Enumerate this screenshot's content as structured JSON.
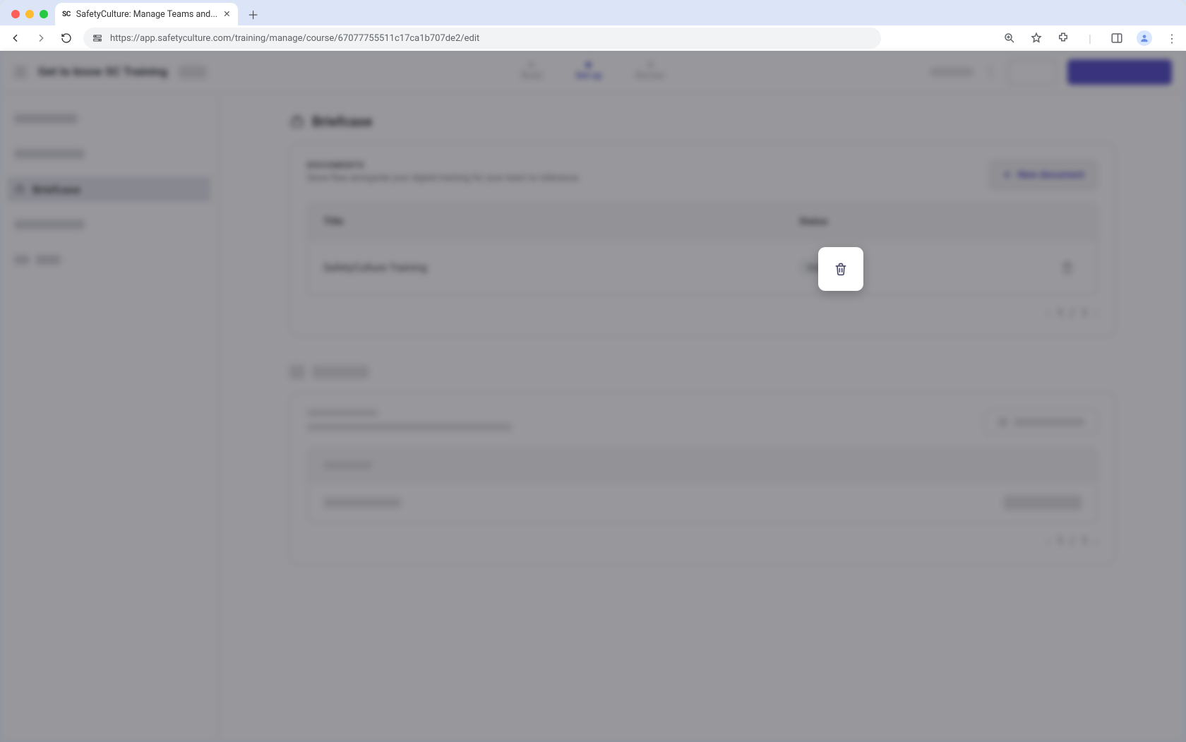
{
  "browser": {
    "tab_title": "SafetyCulture: Manage Teams and...",
    "url": "https://app.safetyculture.com/training/manage/course/67077755511c17ca1b707de2/edit"
  },
  "header": {
    "course_title": "Get to know SC Training",
    "stepper": {
      "step_build": "Build",
      "step_setup": "Set up",
      "step_review": "Review"
    }
  },
  "sidebar": {
    "active_label": "Briefcase"
  },
  "main": {
    "section_title": "Briefcase",
    "documents": {
      "label": "DOCUMENTS",
      "subtext": "Store files alongside your digital training for your team to reference.",
      "new_button": "New document",
      "columns": {
        "title": "Title",
        "status": "Status"
      },
      "rows": [
        {
          "title": "SafetyCulture Training",
          "status": "Draft"
        }
      ],
      "pager": {
        "current": "1",
        "sep": "/",
        "total": "1"
      }
    },
    "second_pager": {
      "current": "1",
      "sep": "/",
      "total": "1"
    }
  }
}
